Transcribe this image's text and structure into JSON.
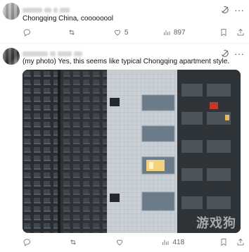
{
  "tweets": [
    {
      "text": "Chongqing China, coooooool",
      "actions": {
        "reply": "",
        "repost": "",
        "like": "5",
        "views": "897"
      }
    },
    {
      "text": "(my photo) Yes, this seems like typical Chongqing apartment style.",
      "actions": {
        "reply": "",
        "repost": "",
        "like": "",
        "views": "418"
      }
    }
  ],
  "icons": {
    "grok": "grok-icon",
    "more": "more-horizontal-icon",
    "reply": "reply-icon",
    "repost": "repost-icon",
    "like": "heart-icon",
    "views": "views-icon",
    "bookmark": "bookmark-icon",
    "share": "share-icon"
  },
  "watermark": "游戏狗",
  "colors": {
    "text": "#0f1419",
    "muted": "#536471",
    "divider": "#eff3f4"
  }
}
